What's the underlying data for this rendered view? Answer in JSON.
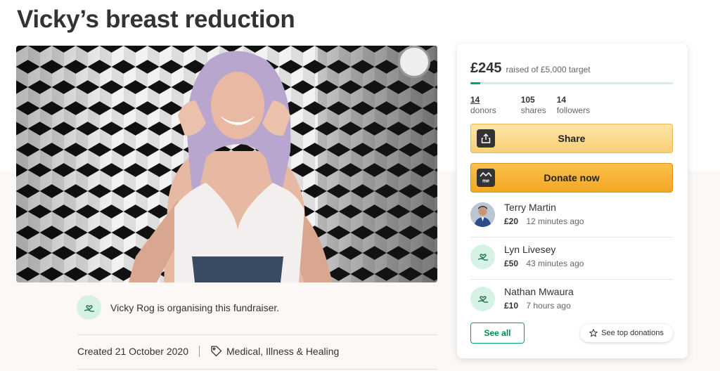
{
  "page": {
    "title": "Vicky’s breast reduction"
  },
  "hero": {
    "image_alt": "Fundraiser photo"
  },
  "organiser": {
    "text": "Vicky Rog is organising this fundraiser."
  },
  "meta": {
    "created": "Created 21 October 2020",
    "category": "Medical, Illness & Healing"
  },
  "card": {
    "raised_amount": "£245",
    "raised_target": "raised of £5,000 target",
    "progress_fraction": 0.049,
    "stats": [
      {
        "value": "14",
        "label": "donors"
      },
      {
        "value": "105",
        "label": "shares"
      },
      {
        "value": "14",
        "label": "followers"
      }
    ],
    "share_label": "Share",
    "donate_label": "Donate now",
    "donate_icon_text": "me",
    "donations": [
      {
        "name": "Terry Martin",
        "amount": "£20",
        "time": "12 minutes ago",
        "avatar": "photo"
      },
      {
        "name": "Lyn Livesey",
        "amount": "£50",
        "time": "43 minutes ago",
        "avatar": "heart-hand-icon"
      },
      {
        "name": "Nathan Mwaura",
        "amount": "£10",
        "time": "7 hours ago",
        "avatar": "heart-hand-icon"
      }
    ],
    "see_all_label": "See all",
    "see_top_label": "See top donations"
  },
  "colors": {
    "brand_green": "#02a95c",
    "share_yellow": "#f8cf76",
    "donate_orange": "#f5a623",
    "avatar_mint": "#d6f2e7"
  }
}
